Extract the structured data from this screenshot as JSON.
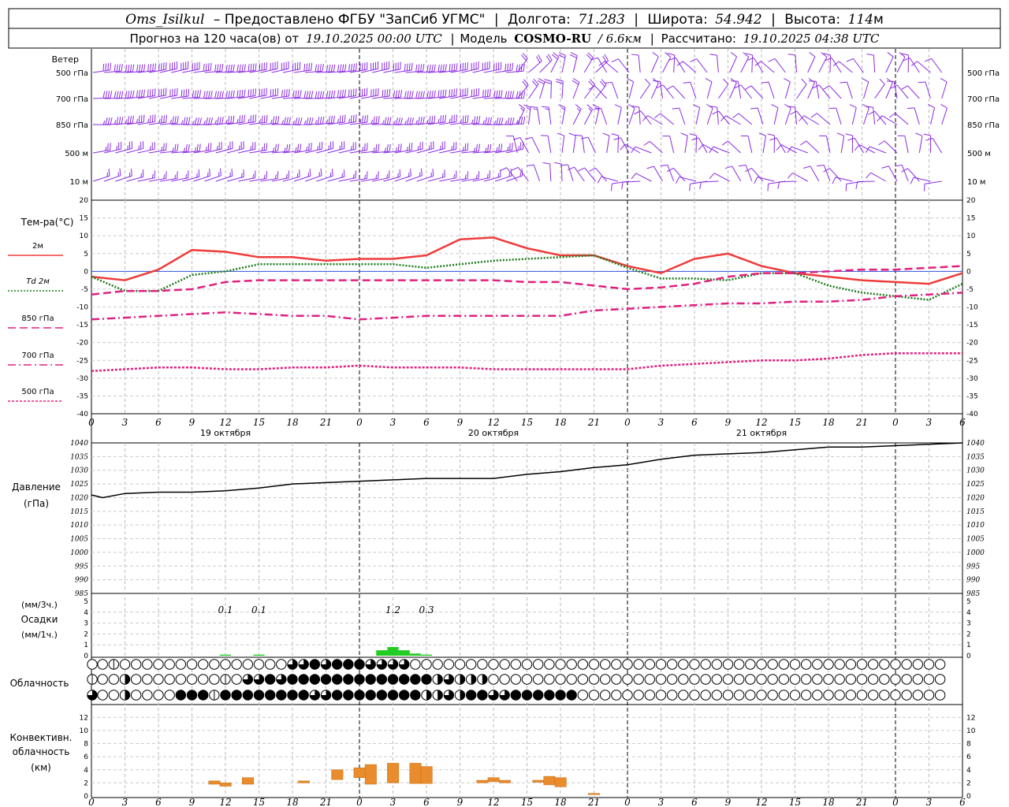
{
  "header": {
    "station": "Oms_Isilkul",
    "provider": "– Предоставлено ФГБУ \"ЗапСиб УГМС\"",
    "lon_label": "Долгота:",
    "lon": "71.283",
    "lat_label": "Широта:",
    "lat": "54.942",
    "alt_label": "Высота:",
    "alt": "114",
    "alt_unit": "м",
    "forecast_text": "Прогноз на 120 часа(ов) от",
    "forecast_time": "19.10.2025 00:00 UTC",
    "model_label": "Модель",
    "model": "COSMO-RU",
    "model_res": "/ 6.6км",
    "calc_label": "Рассчитано:",
    "calc_time": "19.10.2025 04:38 UTC"
  },
  "wind": {
    "title": "Ветер",
    "levels": [
      "500 гПа",
      "700 гПа",
      "850 гПа",
      "500 м",
      "10  м"
    ],
    "color": "#8a2be2"
  },
  "temperature": {
    "title": "Тем-ра(°C)",
    "legend": [
      {
        "label": "2м",
        "color": "#ee3b3b",
        "style": "solid"
      },
      {
        "label": "Td  2м",
        "color": "#1a7a1a",
        "style": "dotted"
      },
      {
        "label": "850 гПа",
        "color": "#e0207f",
        "style": "dash"
      },
      {
        "label": "700 гПа",
        "color": "#e0207f",
        "style": "dashdot"
      },
      {
        "label": "500 гПа",
        "color": "#e0207f",
        "style": "dot"
      }
    ],
    "yticks": [
      "20",
      "15",
      "10",
      "5",
      "0",
      "-5",
      "-10",
      "-15",
      "-20",
      "-25",
      "-30",
      "-35",
      "-40"
    ]
  },
  "time_axis": {
    "hours": [
      "0",
      "3",
      "6",
      "9",
      "12",
      "15",
      "18",
      "21",
      "0",
      "3",
      "6",
      "9",
      "12",
      "15",
      "18",
      "21",
      "0",
      "3",
      "6",
      "9",
      "12",
      "15",
      "18",
      "21",
      "0",
      "3",
      "6"
    ],
    "days": [
      "19 октября",
      "20 октября",
      "21 октября"
    ]
  },
  "pressure": {
    "title": "Давление",
    "unit": "(гПа)",
    "yticks": [
      "1040",
      "1035",
      "1030",
      "1025",
      "1020",
      "1015",
      "1010",
      "1005",
      "1000",
      "995",
      "990",
      "985"
    ]
  },
  "precip": {
    "unit3": "(мм/3ч.)",
    "title": "Осадки",
    "unit1": "(мм/1ч.)",
    "yticks": [
      "5",
      "4",
      "3",
      "2",
      "1",
      "0"
    ],
    "totals": [
      {
        "hour": 12,
        "value": "0.1"
      },
      {
        "hour": 15,
        "value": "0.1"
      },
      {
        "hour": 27,
        "value": "1.2"
      },
      {
        "hour": 30,
        "value": "0.3"
      }
    ]
  },
  "cloud": {
    "title": "Облачность"
  },
  "convective": {
    "title1": "Конвективн.",
    "title2": "облачность",
    "unit": "(км)",
    "yticks": [
      "12",
      "10",
      "8",
      "6",
      "4",
      "2",
      "0"
    ]
  },
  "chart_data": [
    {
      "type": "line",
      "title": "Тем-ра(°C)",
      "x_hours": [
        0,
        3,
        6,
        9,
        12,
        15,
        18,
        21,
        24,
        27,
        30,
        33,
        36,
        39,
        42,
        45,
        48,
        51,
        54,
        57,
        60,
        63,
        66,
        69,
        72,
        75,
        78
      ],
      "ylim": [
        -40,
        20
      ],
      "series": [
        {
          "name": "2м",
          "values": [
            -1.5,
            -2.5,
            0.5,
            6,
            5.5,
            4,
            4,
            3,
            3.5,
            3.5,
            4.5,
            9,
            9.5,
            6.5,
            4.5,
            4.5,
            1.5,
            -0.5,
            3.5,
            5,
            1.5,
            -0.5,
            -1.5,
            -2.5,
            -3,
            -3.5,
            -0.5
          ]
        },
        {
          "name": "Td  2м",
          "values": [
            -1.5,
            -5.5,
            -5.5,
            -1,
            0,
            2,
            2,
            2,
            2,
            2,
            1,
            2,
            3,
            3.5,
            4,
            4.5,
            1,
            -2,
            -2,
            -2.5,
            -0.5,
            -0.5,
            -4,
            -6,
            -7,
            -8,
            -3.5
          ]
        },
        {
          "name": "850 гПа",
          "values": [
            -6.5,
            -5.5,
            -5.5,
            -5,
            -3,
            -2.5,
            -2.5,
            -2.5,
            -2.5,
            -2.5,
            -2.5,
            -2.5,
            -2.5,
            -3,
            -3,
            -4,
            -5,
            -4.5,
            -3.5,
            -1.5,
            -0.5,
            -0.5,
            0,
            0.5,
            0.5,
            1,
            1.5
          ]
        },
        {
          "name": "700 гПа",
          "values": [
            -13.5,
            -13,
            -12.5,
            -12,
            -11.5,
            -12,
            -12.5,
            -12.5,
            -13.5,
            -13,
            -12.5,
            -12.5,
            -12.5,
            -12.5,
            -12.5,
            -11,
            -10.5,
            -10,
            -9.5,
            -9,
            -9,
            -8.5,
            -8.5,
            -8,
            -7,
            -6.5,
            -6
          ]
        },
        {
          "name": "500 гПа",
          "values": [
            -28,
            -27.5,
            -27,
            -27,
            -27.5,
            -27.5,
            -27,
            -27,
            -26.5,
            -27,
            -27,
            -27,
            -27.5,
            -27.5,
            -27.5,
            -27.5,
            -27.5,
            -26.5,
            -26,
            -25.5,
            -25,
            -25,
            -24.5,
            -23.5,
            -23,
            -23,
            -23
          ]
        }
      ]
    },
    {
      "type": "line",
      "title": "Давление",
      "x_hours": [
        0,
        1,
        3,
        6,
        9,
        12,
        15,
        18,
        21,
        24,
        27,
        30,
        33,
        36,
        39,
        42,
        45,
        48,
        51,
        54,
        57,
        60,
        63,
        66,
        69,
        72,
        75,
        78
      ],
      "ylim": [
        985,
        1040
      ],
      "series": [
        {
          "name": "Давление",
          "values": [
            1021,
            1020,
            1021.5,
            1022,
            1022,
            1022.5,
            1023.5,
            1025,
            1025.5,
            1026,
            1026.5,
            1027,
            1027,
            1027,
            1028.5,
            1029.5,
            1031,
            1032,
            1034,
            1035.5,
            1036,
            1036.5,
            1037.5,
            1038.5,
            1038.5,
            1039,
            1039.5,
            1040
          ]
        }
      ]
    },
    {
      "type": "bar",
      "title": "Осадки",
      "x_hours": [
        12,
        15,
        26,
        27,
        28,
        29,
        30
      ],
      "ylim": [
        0,
        5
      ],
      "series": [
        {
          "name": "мм/1ч",
          "values": [
            0.1,
            0.1,
            0.5,
            0.8,
            0.5,
            0.2,
            0.1
          ]
        }
      ]
    },
    {
      "type": "bar",
      "title": "Конвективн. облачность",
      "ylim": [
        0,
        13
      ],
      "series": [
        {
          "name": "base_top_km",
          "values": [
            [
              11,
              1.8,
              2.3
            ],
            [
              12,
              1.5,
              2
            ],
            [
              14,
              1.8,
              2.8
            ],
            [
              19,
              2,
              2.3
            ],
            [
              22,
              2.5,
              4
            ],
            [
              24,
              2.8,
              4.3
            ],
            [
              25,
              1.8,
              4.8
            ],
            [
              27,
              2,
              5
            ],
            [
              29,
              1.9,
              5
            ],
            [
              30,
              1.9,
              4.5
            ],
            [
              35,
              2,
              2.4
            ],
            [
              36,
              2.2,
              2.8
            ],
            [
              37,
              2,
              2.4
            ],
            [
              40,
              2.1,
              2.4
            ],
            [
              41,
              1.7,
              3
            ],
            [
              42,
              1.4,
              2.8
            ],
            [
              45,
              0.2,
              0.4
            ]
          ]
        }
      ]
    },
    {
      "type": "table",
      "title": "Облачность",
      "rows": [
        [
          0,
          0,
          1,
          0,
          0,
          0,
          0,
          0,
          0,
          0,
          0,
          0,
          0,
          0,
          0,
          0,
          0,
          0,
          3,
          3,
          4,
          3,
          4,
          4,
          4,
          3,
          3,
          3,
          3,
          0,
          0,
          0,
          0,
          0,
          0,
          0,
          0,
          0,
          0,
          0,
          0,
          0,
          0,
          0,
          0,
          0,
          0,
          0,
          0,
          0,
          0,
          0,
          0,
          0,
          0,
          0,
          0,
          0,
          0,
          0,
          0,
          0,
          0,
          0,
          0,
          0,
          0,
          0,
          0,
          0,
          0,
          0,
          0,
          0,
          0,
          0,
          0
        ],
        [
          1,
          0,
          0,
          2,
          0,
          0,
          0,
          0,
          0,
          0,
          0,
          0,
          1,
          0,
          3,
          3,
          4,
          3,
          4,
          4,
          4,
          4,
          4,
          4,
          4,
          4,
          4,
          4,
          4,
          4,
          4,
          2,
          3,
          2,
          2,
          2,
          0,
          0,
          0,
          0,
          0,
          0,
          0,
          0,
          0,
          0,
          0,
          0,
          0,
          0,
          0,
          0,
          0,
          0,
          0,
          0,
          0,
          0,
          0,
          0,
          0,
          0,
          0,
          0,
          0,
          0,
          0,
          0,
          0,
          0,
          0,
          0,
          0,
          0,
          0,
          0,
          0
        ],
        [
          3,
          0,
          0,
          2,
          0,
          0,
          0,
          0,
          4,
          4,
          4,
          1,
          4,
          4,
          4,
          4,
          4,
          4,
          4,
          4,
          3,
          3,
          4,
          4,
          4,
          4,
          4,
          4,
          4,
          4,
          2,
          2,
          3,
          2,
          4,
          4,
          3,
          3,
          4,
          4,
          4,
          4,
          4,
          4,
          0,
          0,
          0,
          0,
          0,
          0,
          0,
          0,
          0,
          0,
          0,
          0,
          0,
          0,
          0,
          0,
          0,
          0,
          0,
          0,
          0,
          0,
          0,
          0,
          0,
          0,
          0,
          0,
          0,
          0,
          0,
          0,
          0
        ]
      ]
    }
  ]
}
